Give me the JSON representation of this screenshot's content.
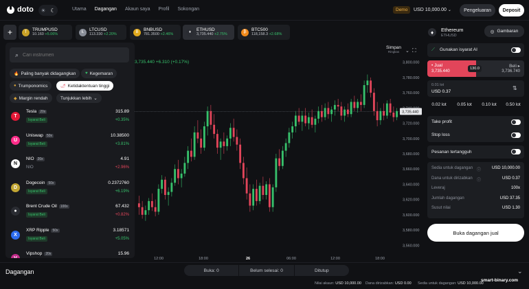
{
  "app": {
    "logo": "doto"
  },
  "nav": [
    "Utama",
    "Dagangan",
    "Akaun saya",
    "Profil",
    "Sokongan"
  ],
  "nav_active": 1,
  "header": {
    "demo_label": "Demo",
    "balance": "USD 10,000.00",
    "withdraw": "Pengeluaran",
    "deposit": "Deposit"
  },
  "tickers": [
    {
      "name": "TRUMPUSD",
      "price": "10.160",
      "change": "+5.06%",
      "color": "#c9a227",
      "glyph": "T"
    },
    {
      "name": "LTCUSD",
      "price": "113.330",
      "change": "+2.20%",
      "color": "#8a8f99",
      "glyph": "Ł"
    },
    {
      "name": "BNBUSD",
      "price": "781.3500",
      "change": "+2.46%",
      "color": "#e0a81c",
      "glyph": "B"
    },
    {
      "name": "ETHUSD",
      "price": "3,735.440",
      "change": "+2.75%",
      "color": "#eeeeee",
      "glyph": "♦"
    },
    {
      "name": "BTC500",
      "price": "118,158.3",
      "change": "+2.68%",
      "color": "#f0891a",
      "glyph": "₿"
    }
  ],
  "search": {
    "placeholder": "Cari instrumen"
  },
  "chips": [
    "Paling banyak didagangkan",
    "Kegemaran",
    "Trumponomics",
    "Ketidaktentuan tinggi",
    "Margin rendah",
    "Tunjukkan lebih"
  ],
  "instruments": [
    {
      "name": "Tesla",
      "leverage": "20x",
      "signal": "Isyarat Beli",
      "sub": "",
      "price": "315.89",
      "change": "+0.35%",
      "dir": "pos",
      "color": "#e31937",
      "glyph": "T"
    },
    {
      "name": "Uniswap",
      "leverage": "50x",
      "signal": "Isyarat Beli",
      "sub": "",
      "price": "10.38500",
      "change": "+3.81%",
      "dir": "pos",
      "color": "#ff2d8a",
      "glyph": "U"
    },
    {
      "name": "NIO",
      "leverage": "20x",
      "signal": "",
      "sub": "NIO",
      "price": "4.91",
      "change": "+2.96%",
      "dir": "neg",
      "color": "#ffffff",
      "glyph": "N"
    },
    {
      "name": "Dogecoin",
      "leverage": "50x",
      "signal": "Isyarat Beli",
      "sub": "",
      "price": "0.2372760",
      "change": "+6.19%",
      "dir": "pos",
      "color": "#c2a633",
      "glyph": "D"
    },
    {
      "name": "Brent Crude Oil",
      "leverage": "100x",
      "signal": "Isyarat Beli",
      "sub": "",
      "price": "67.432",
      "change": "+0.82%",
      "dir": "neg",
      "color": "#2a2c32",
      "glyph": "●"
    },
    {
      "name": "XRP Ripple",
      "leverage": "50x",
      "signal": "Isyarat Beli",
      "sub": "",
      "price": "3.18571",
      "change": "+5.05%",
      "dir": "pos",
      "color": "#2c6cf0",
      "glyph": "X"
    },
    {
      "name": "Vipshop",
      "leverage": "20x",
      "signal": "",
      "sub": "",
      "price": "15.96",
      "change": "",
      "dir": "pos",
      "color": "#c22b8a",
      "glyph": "V"
    }
  ],
  "chart_overlay": {
    "ohlc_text": "3,735.440 +6.310 (+0.17%)",
    "save_label": "Simpan",
    "save_sub": "Ringkas",
    "last_price": "3,735.440"
  },
  "chart_data": {
    "type": "candlestick",
    "y_ticks": [
      "3,800.000",
      "3,780.000",
      "3,760.000",
      "3,740.000",
      "3,720.000",
      "3,700.000",
      "3,680.000",
      "3,660.000",
      "3,640.000",
      "3,620.000",
      "3,600.000",
      "3,580.000",
      "3,560.000"
    ],
    "x_ticks": [
      "12:00",
      "18:00",
      "26",
      "06:00",
      "12:00",
      "18:00"
    ],
    "ylim": [
      3554,
      3806
    ],
    "last_price": 3735.44,
    "candles": [
      [
        3615,
        3625,
        3600,
        3610
      ],
      [
        3610,
        3618,
        3595,
        3600
      ],
      [
        3600,
        3612,
        3592,
        3606
      ],
      [
        3606,
        3622,
        3600,
        3618
      ],
      [
        3618,
        3628,
        3605,
        3610
      ],
      [
        3610,
        3620,
        3598,
        3604
      ],
      [
        3604,
        3640,
        3600,
        3634
      ],
      [
        3634,
        3652,
        3628,
        3646
      ],
      [
        3646,
        3650,
        3620,
        3626
      ],
      [
        3626,
        3636,
        3612,
        3630
      ],
      [
        3630,
        3648,
        3624,
        3642
      ],
      [
        3642,
        3666,
        3638,
        3660
      ],
      [
        3660,
        3672,
        3640,
        3648
      ],
      [
        3648,
        3660,
        3636,
        3654
      ],
      [
        3654,
        3676,
        3650,
        3668
      ],
      [
        3668,
        3690,
        3660,
        3684
      ],
      [
        3684,
        3700,
        3670,
        3676
      ],
      [
        3676,
        3716,
        3672,
        3708
      ],
      [
        3708,
        3724,
        3694,
        3700
      ],
      [
        3700,
        3712,
        3680,
        3688
      ],
      [
        3688,
        3722,
        3684,
        3716
      ],
      [
        3716,
        3742,
        3704,
        3736
      ],
      [
        3736,
        3744,
        3712,
        3718
      ],
      [
        3718,
        3732,
        3700,
        3706
      ],
      [
        3706,
        3712,
        3680,
        3688
      ],
      [
        3688,
        3700,
        3672,
        3696
      ],
      [
        3696,
        3708,
        3680,
        3690
      ],
      [
        3690,
        3704,
        3684,
        3700
      ],
      [
        3700,
        3720,
        3690,
        3714
      ],
      [
        3714,
        3726,
        3696,
        3702
      ],
      [
        3702,
        3712,
        3684,
        3692
      ],
      [
        3692,
        3700,
        3660,
        3668
      ],
      [
        3668,
        3676,
        3640,
        3648
      ],
      [
        3648,
        3662,
        3620,
        3628
      ],
      [
        3628,
        3640,
        3604,
        3612
      ],
      [
        3612,
        3640,
        3606,
        3634
      ],
      [
        3634,
        3646,
        3612,
        3618
      ],
      [
        3618,
        3642,
        3614,
        3638
      ],
      [
        3638,
        3650,
        3620,
        3626
      ],
      [
        3626,
        3644,
        3620,
        3640
      ],
      [
        3640,
        3648,
        3604,
        3610
      ],
      [
        3610,
        3640,
        3604,
        3636
      ],
      [
        3636,
        3680,
        3630,
        3674
      ],
      [
        3674,
        3686,
        3658,
        3664
      ],
      [
        3664,
        3690,
        3660,
        3684
      ],
      [
        3684,
        3700,
        3676,
        3694
      ],
      [
        3694,
        3714,
        3688,
        3708
      ],
      [
        3708,
        3722,
        3700,
        3716
      ],
      [
        3716,
        3736,
        3708,
        3730
      ],
      [
        3730,
        3740,
        3718,
        3722
      ],
      [
        3722,
        3736,
        3710,
        3730
      ],
      [
        3730,
        3740,
        3716,
        3720
      ],
      [
        3720,
        3734,
        3712,
        3728
      ],
      [
        3728,
        3738,
        3714,
        3718
      ],
      [
        3718,
        3730,
        3708,
        3726
      ],
      [
        3726,
        3742,
        3720,
        3736
      ],
      [
        3736,
        3744,
        3722,
        3728
      ],
      [
        3728,
        3746,
        3724,
        3740
      ],
      [
        3740,
        3748,
        3726,
        3732
      ],
      [
        3732,
        3742,
        3722,
        3738
      ],
      [
        3738,
        3750,
        3730,
        3744
      ],
      [
        3744,
        3752,
        3736,
        3742
      ],
      [
        3742,
        3748,
        3724,
        3730
      ],
      [
        3730,
        3742,
        3722,
        3738
      ],
      [
        3738,
        3746,
        3728,
        3732
      ],
      [
        3732,
        3752,
        3728,
        3748
      ],
      [
        3748,
        3756,
        3736,
        3740
      ],
      [
        3740,
        3752,
        3734,
        3748
      ],
      [
        3748,
        3758,
        3736,
        3744
      ],
      [
        3744,
        3776,
        3740,
        3770
      ],
      [
        3770,
        3784,
        3760,
        3776
      ],
      [
        3776,
        3780,
        3754,
        3760
      ],
      [
        3760,
        3766,
        3730,
        3736
      ],
      [
        3736,
        3748,
        3716,
        3724
      ],
      [
        3724,
        3740,
        3718,
        3736
      ],
      [
        3736,
        3746,
        3724,
        3730
      ],
      [
        3730,
        3750,
        3726,
        3746
      ],
      [
        3746,
        3752,
        3730,
        3734
      ],
      [
        3734,
        3742,
        3722,
        3728
      ],
      [
        3728,
        3740,
        3724,
        3736
      ]
    ]
  },
  "right": {
    "asset": "Ethereum",
    "symbol": "ETHUSD",
    "chart_btn": "Gambaran",
    "ai_signal": "Gunakan isyarat AI",
    "sell_label": "Jual",
    "sell_price": "3,735.440",
    "spread": "130.0",
    "buy_label": "Beli",
    "buy_price": "3,736.740",
    "lot_label": "0.01 lot",
    "lot_value": "USD 0.37",
    "lots": [
      "0.02 lot",
      "0.05 lot",
      "0.10 lot",
      "0.50 lot"
    ],
    "take_profit": "Take profit",
    "stop_loss": "Stop loss",
    "pending": "Pesanan tertangguh",
    "info": [
      {
        "k": "Sedia untuk dagangan",
        "v": "USD 10,000.00"
      },
      {
        "k": "Dana untuk dirizabkan",
        "v": "USD 0.37"
      },
      {
        "k": "Leveraj",
        "v": "100x"
      },
      {
        "k": "Jumlah dagangan",
        "v": "USD 37.35"
      },
      {
        "k": "Susut nilai",
        "v": "USD 1.30"
      }
    ],
    "open_btn": "Buka dagangan jual"
  },
  "bottom": {
    "title": "Dagangan",
    "tabs": [
      "Buka: 0",
      "Belum selesai: 0",
      "Ditutup"
    ],
    "status": [
      {
        "k": "Nilai akaun:",
        "v": "USD 10,000.00"
      },
      {
        "k": "Dana dirizabkan:",
        "v": "USD 0.00"
      },
      {
        "k": "Sedia untuk dagangan:",
        "v": "USD 10,000.00"
      }
    ],
    "watermark": "smart-binary.com"
  }
}
